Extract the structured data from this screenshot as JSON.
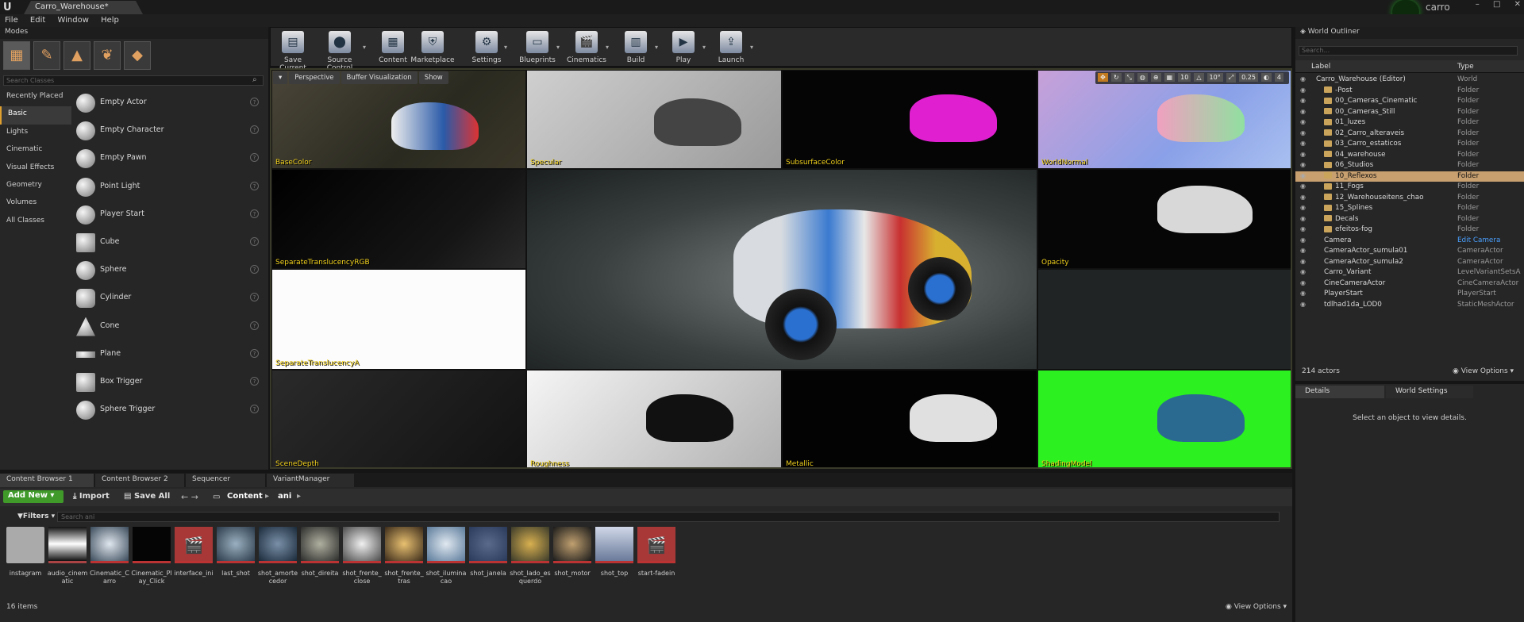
{
  "window": {
    "doc_tab": "Carro_Warehouse*",
    "user": "carro",
    "logo": "U",
    "controls": [
      "–",
      "□",
      "✕"
    ]
  },
  "menu": [
    "File",
    "Edit",
    "Window",
    "Help"
  ],
  "modes": {
    "tab_label": "Modes",
    "search_placeholder": "Search Classes",
    "categories": [
      "Recently Placed",
      "Basic",
      "Lights",
      "Cinematic",
      "Visual Effects",
      "Geometry",
      "Volumes",
      "All Classes"
    ],
    "active_category": "Basic",
    "classes": [
      "Empty Actor",
      "Empty Character",
      "Empty Pawn",
      "Point Light",
      "Player Start",
      "Cube",
      "Sphere",
      "Cylinder",
      "Cone",
      "Plane",
      "Box Trigger",
      "Sphere Trigger"
    ]
  },
  "toolbar": {
    "buttons": [
      "Save Current",
      "Source Control",
      "Content",
      "Marketplace",
      "Settings",
      "Blueprints",
      "Cinematics",
      "Build",
      "Play",
      "Launch"
    ]
  },
  "viewport": {
    "perspective": "Perspective",
    "buffer_viz": "Buffer Visualization",
    "show": "Show",
    "grid_snap": "10",
    "rot_snap": "10°",
    "scale_snap": "0.25",
    "cam_speed": "4",
    "buffers": [
      "BaseColor",
      "Specular",
      "SubsurfaceColor",
      "WorldNormal",
      "SeparateTranslucencyRGB",
      "Opacity",
      "SeparateTranslucencyA",
      "SceneDepth",
      "Roughness",
      "Metallic",
      "ShadingModel"
    ]
  },
  "content_browser": {
    "tabs": [
      "Content Browser 1",
      "Content Browser 2",
      "Sequencer",
      "VariantManager"
    ],
    "add_new": "Add New",
    "import": "Import",
    "save_all": "Save All",
    "path": [
      "Content",
      "ani"
    ],
    "filters": "Filters",
    "search_placeholder": "Search ani",
    "assets": [
      "instagram",
      "audio_cinematic",
      "Cinematic_Carro",
      "Cinematic_Play_Click",
      "interface_ini",
      "last_shot",
      "shot_amortecedor",
      "shot_direita",
      "shot_frente_close",
      "shot_frente_tras",
      "shot_iluminacao",
      "shot_janela",
      "shot_lado_esquerdo",
      "shot_motor",
      "shot_top",
      "start-fadein"
    ],
    "item_count": "16 items",
    "view_options": "View Options"
  },
  "outliner": {
    "tab_label": "World Outliner",
    "search_placeholder": "Search...",
    "col_label": "Label",
    "col_type": "Type",
    "rows": [
      {
        "name": "Carro_Warehouse (Editor)",
        "type": "World"
      },
      {
        "name": "-Post",
        "type": "Folder"
      },
      {
        "name": "00_Cameras_Cinematic",
        "type": "Folder"
      },
      {
        "name": "00_Cameras_Still",
        "type": "Folder"
      },
      {
        "name": "01_luzes",
        "type": "Folder"
      },
      {
        "name": "02_Carro_alteraveis",
        "type": "Folder"
      },
      {
        "name": "03_Carro_estaticos",
        "type": "Folder"
      },
      {
        "name": "04_warehouse",
        "type": "Folder"
      },
      {
        "name": "06_Studios",
        "type": "Folder"
      },
      {
        "name": "10_Reflexos",
        "type": "Folder"
      },
      {
        "name": "11_Fogs",
        "type": "Folder"
      },
      {
        "name": "12_Warehouseitens_chao",
        "type": "Folder"
      },
      {
        "name": "15_Splines",
        "type": "Folder"
      },
      {
        "name": "Decals",
        "type": "Folder"
      },
      {
        "name": "efeitos-fog",
        "type": "Folder"
      },
      {
        "name": "Camera",
        "type": "Edit Camera"
      },
      {
        "name": "CameraActor_sumula01",
        "type": "CameraActor"
      },
      {
        "name": "CameraActor_sumula2",
        "type": "CameraActor"
      },
      {
        "name": "Carro_Variant",
        "type": "LevelVariantSetsA"
      },
      {
        "name": "CineCameraActor",
        "type": "CineCameraActor"
      },
      {
        "name": "PlayerStart",
        "type": "PlayerStart"
      },
      {
        "name": "tdlhad1da_LOD0",
        "type": "StaticMeshActor"
      }
    ],
    "selected_row": "10_Reflexos",
    "actors": "214 actors",
    "view_options": "View Options"
  },
  "details": {
    "tab_details": "Details",
    "tab_world": "World Settings",
    "message": "Select an object to view details."
  }
}
